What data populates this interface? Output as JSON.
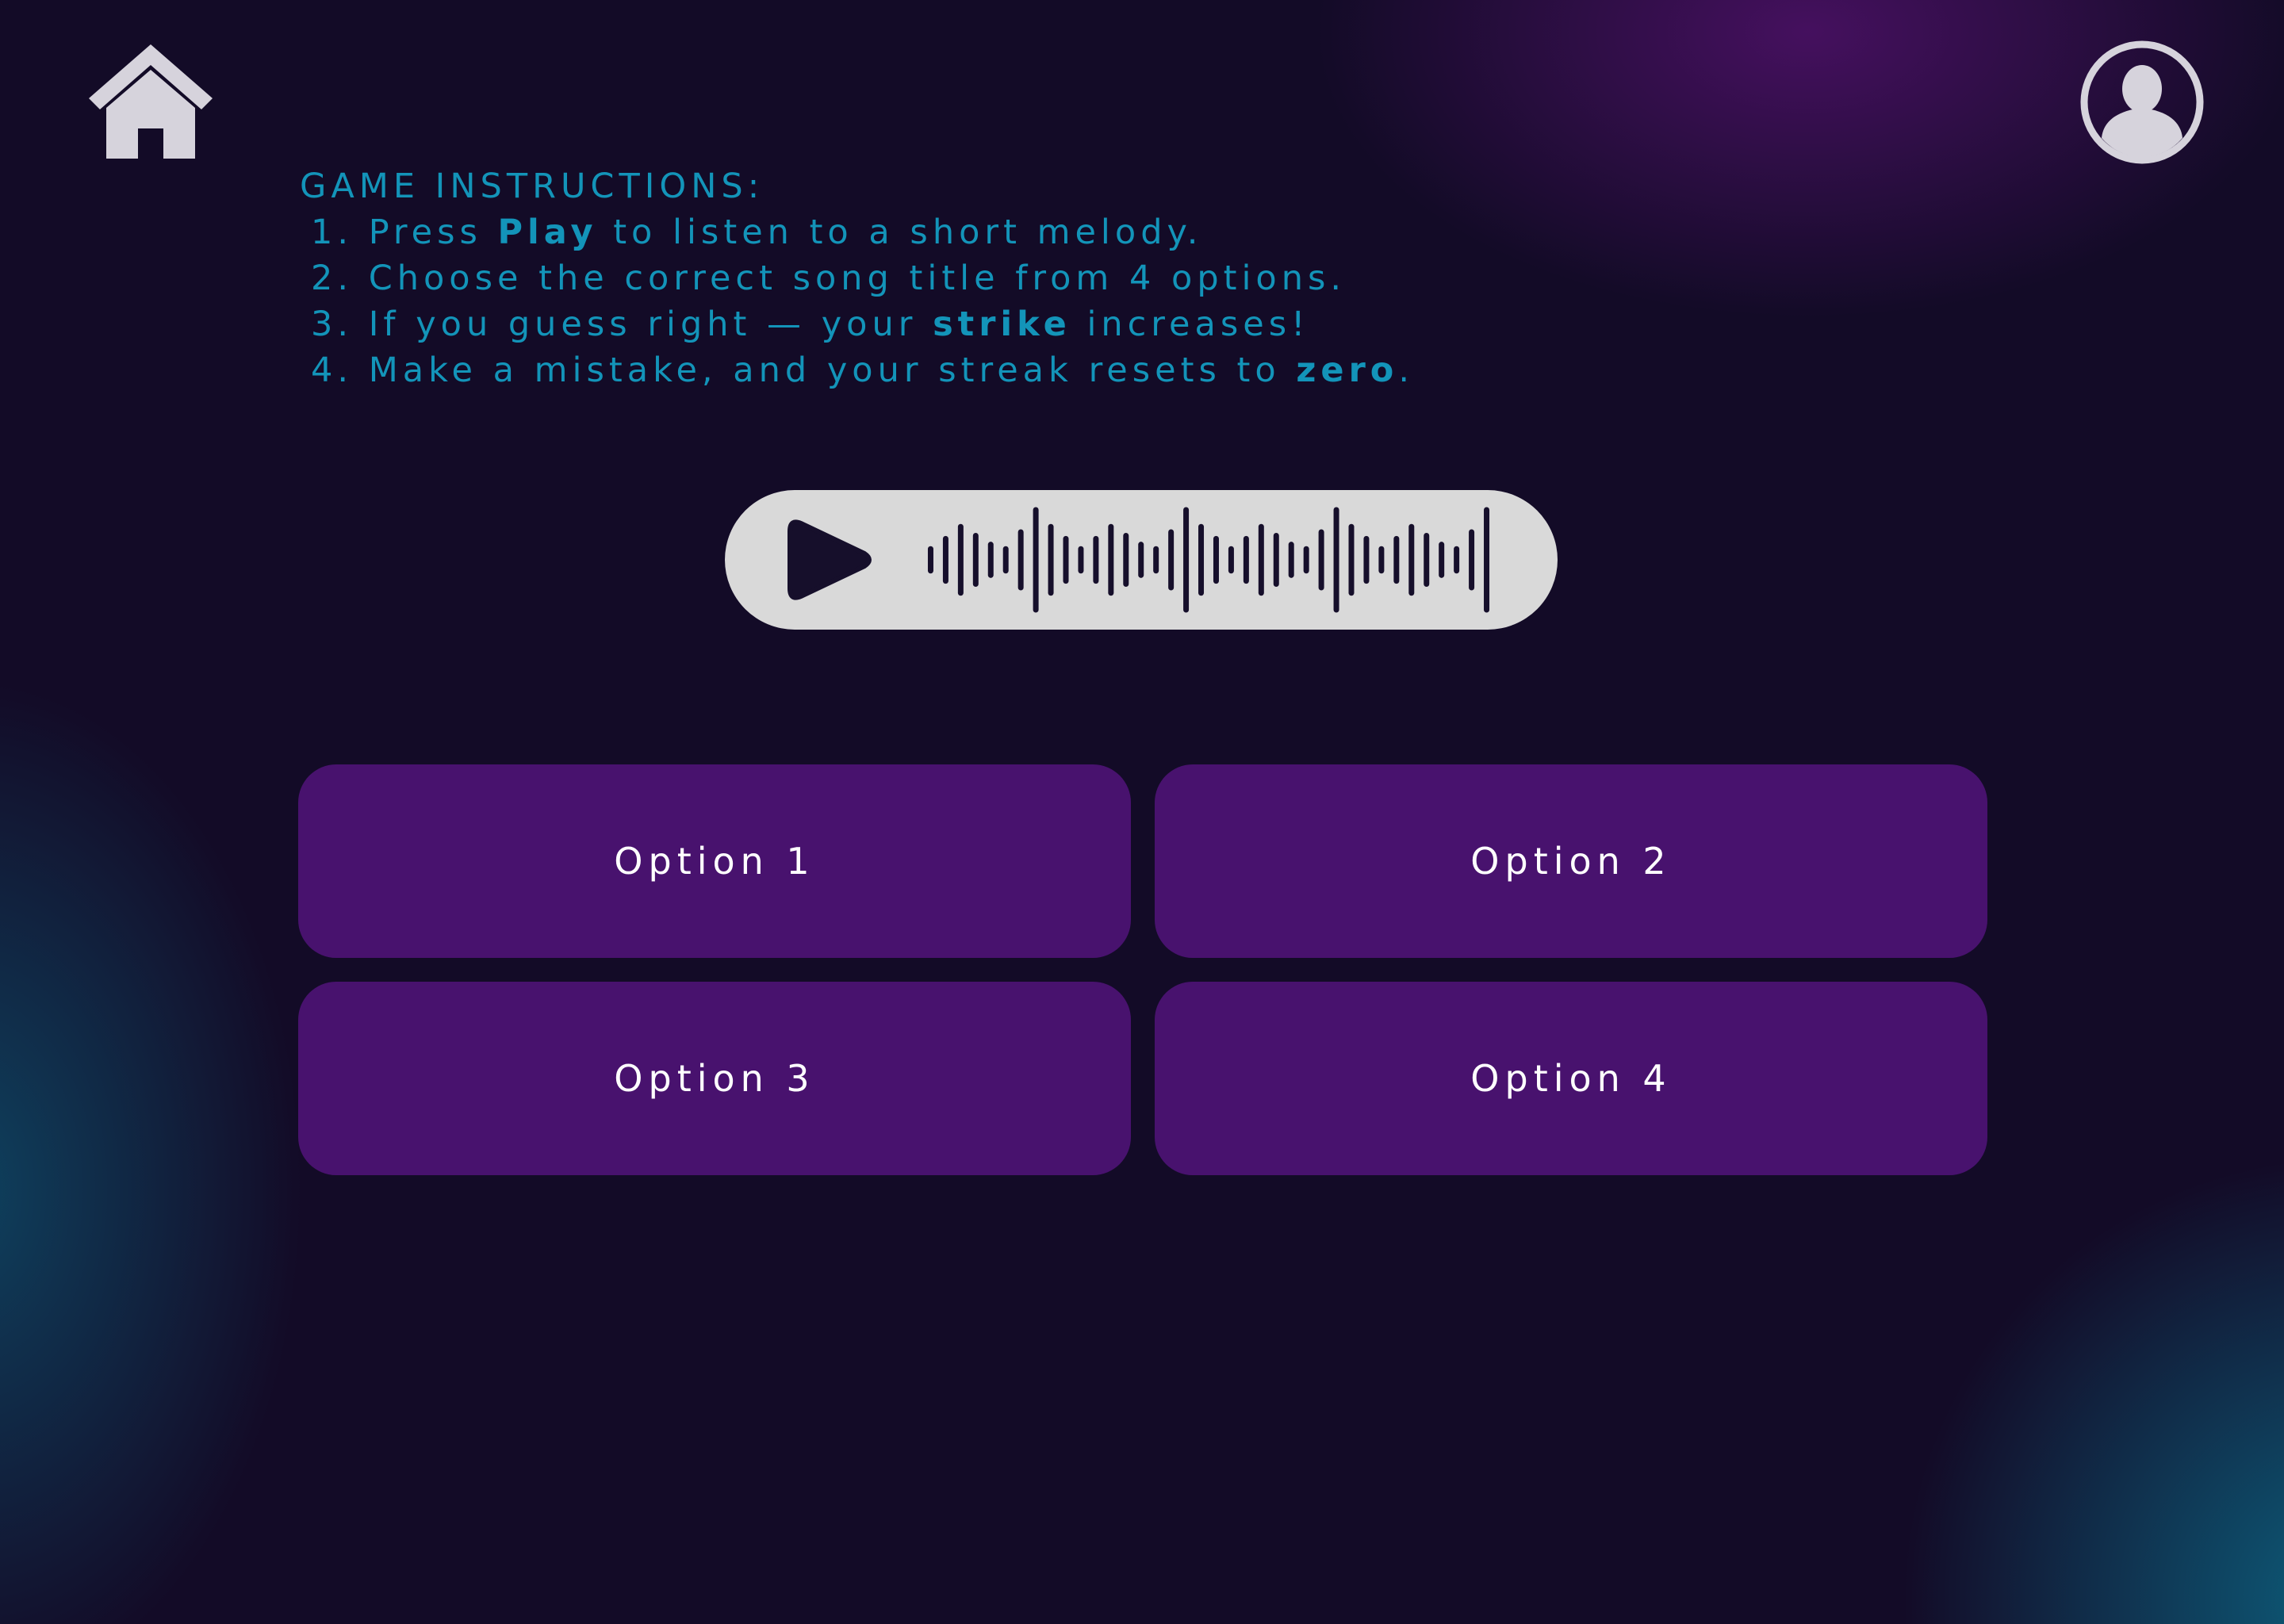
{
  "nav": {
    "home_icon": "home-icon",
    "profile_icon": "user-avatar-icon"
  },
  "instructions": {
    "title": "GAME INSTRUCTIONS:",
    "steps": [
      {
        "number": "1.",
        "before": "Press ",
        "bold": "Play",
        "after": " to listen to a short melody."
      },
      {
        "number": "2.",
        "before": "Choose the correct song title from 4 options.",
        "bold": "",
        "after": ""
      },
      {
        "number": "3.",
        "before": "If you guess right — your ",
        "bold": "strike",
        "after": " increases!"
      },
      {
        "number": "4.",
        "before": "Make a mistake, and your streak resets to ",
        "bold": "zero",
        "after": "."
      }
    ]
  },
  "player": {
    "play_icon": "play-icon",
    "waveform_icon": "waveform-icon"
  },
  "options": [
    {
      "label": "Option 1"
    },
    {
      "label": "Option 2"
    },
    {
      "label": "Option 3"
    },
    {
      "label": "Option 4"
    }
  ],
  "colors": {
    "background": "#130b27",
    "instruction_text": "#1394b9",
    "option_button": "#48126e",
    "player_pill": "#d9d9d9",
    "icon_light": "#d6d3dc",
    "icon_dark": "#160f2b"
  }
}
